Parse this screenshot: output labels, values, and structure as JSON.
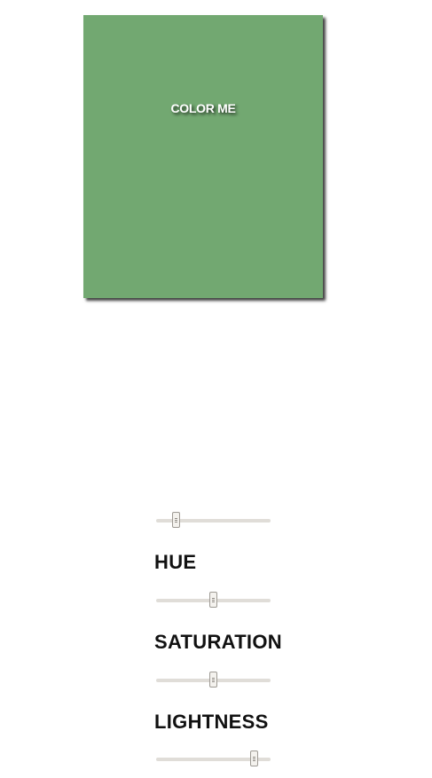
{
  "swatch": {
    "label": "COLOR ME",
    "color": "#72a871"
  },
  "controls": [
    {
      "id": "unnamed",
      "label": "",
      "value_fraction": 0.18
    },
    {
      "id": "hue",
      "label": "HUE",
      "value_fraction": 0.5
    },
    {
      "id": "saturation",
      "label": "SATURATION",
      "value_fraction": 0.5
    },
    {
      "id": "lightness",
      "label": "LIGHTNESS",
      "value_fraction": 0.86
    }
  ],
  "colors": {
    "track": "#e0ddd8",
    "thumb": "#f4f2ee",
    "thumb_border": "#9e9a94",
    "label_text": "#111111"
  }
}
